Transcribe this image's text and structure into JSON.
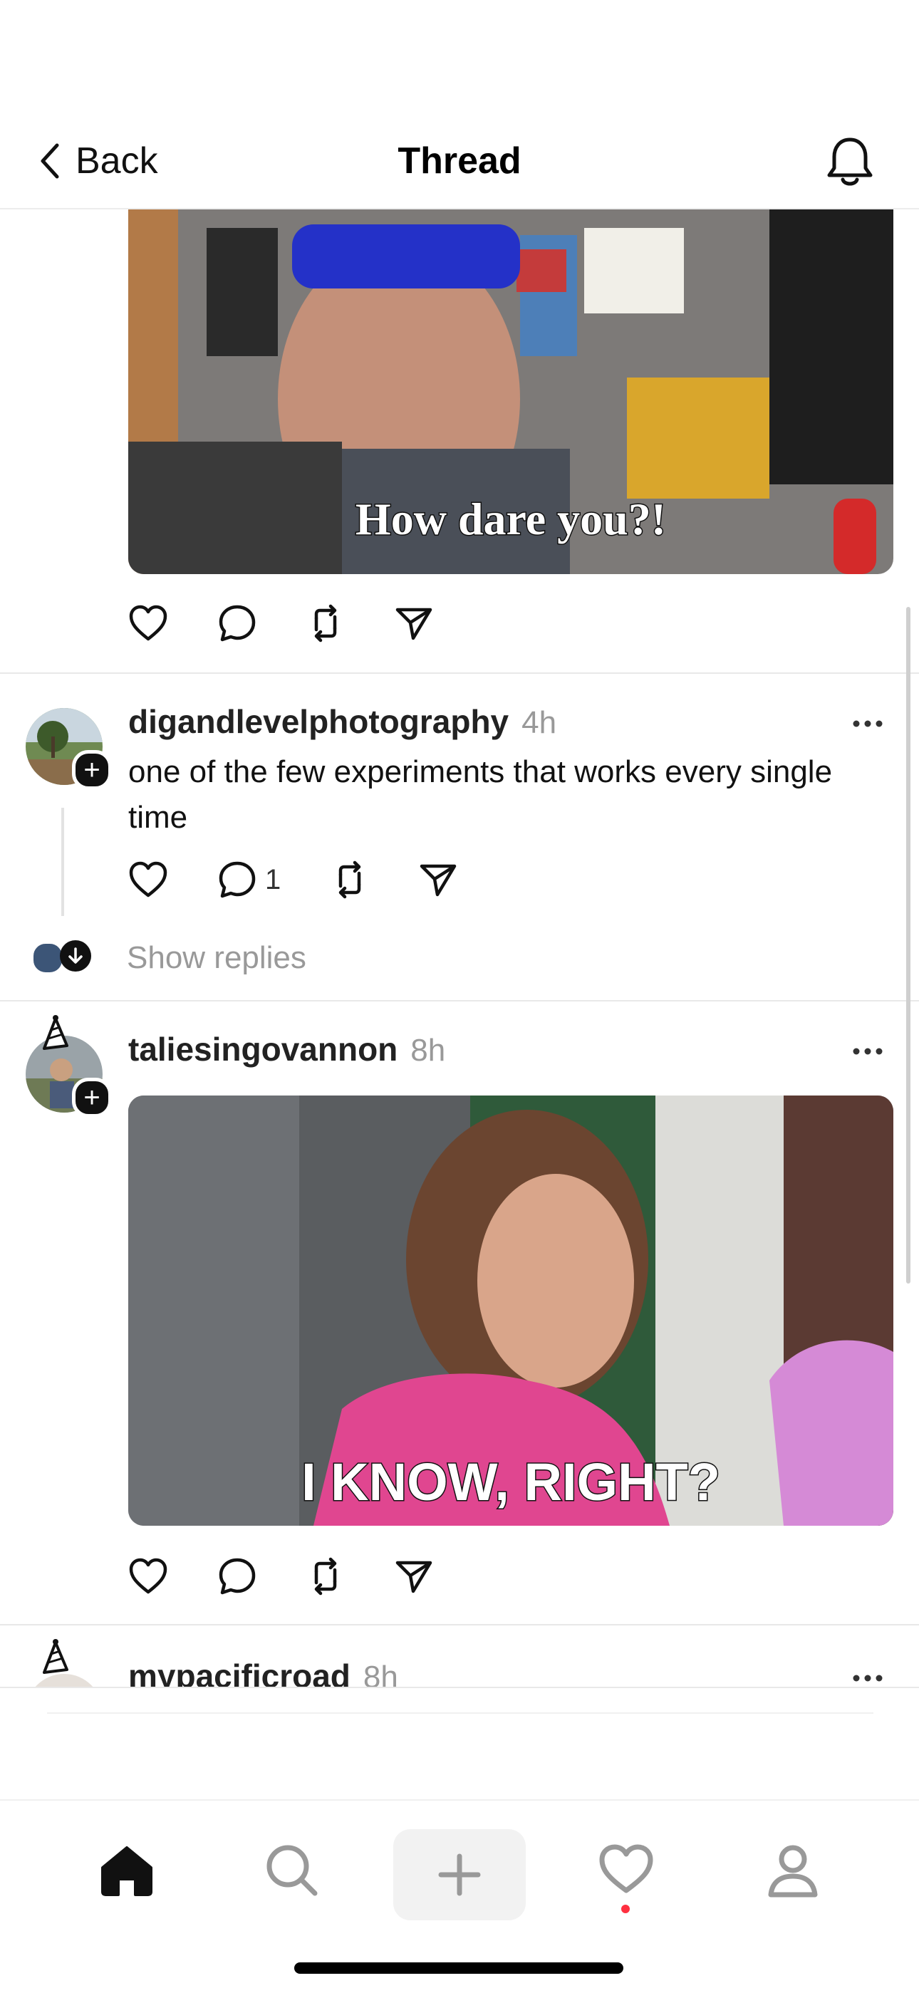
{
  "header": {
    "back_label": "Back",
    "title": "Thread"
  },
  "posts": [
    {
      "media_caption": "How dare you?!"
    },
    {
      "username": "digandlevelphotography",
      "time": "4h",
      "text": "one of the few experiments that works every single time",
      "reply_count": "1",
      "show_replies": "Show replies"
    },
    {
      "username": "taliesingovannon",
      "time": "8h",
      "media_caption": "I KNOW, RIGHT?"
    },
    {
      "username": "mypacificroad",
      "time": "8h"
    }
  ],
  "nav": {
    "items": [
      "home-icon",
      "search-icon",
      "plus-icon",
      "heart-icon",
      "profile-icon"
    ],
    "activity_dot_color": "#ff3040"
  }
}
